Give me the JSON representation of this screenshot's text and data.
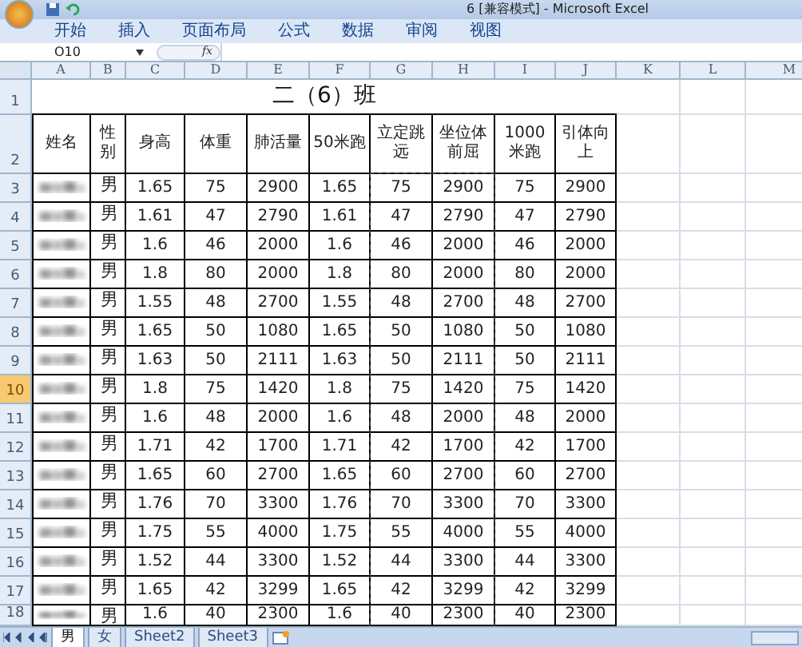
{
  "window": {
    "title": "6 [兼容模式] - Microsoft Excel"
  },
  "ribbon_tabs": [
    "开始",
    "插入",
    "页面布局",
    "公式",
    "数据",
    "审阅",
    "视图"
  ],
  "formula_bar": {
    "name_box": "O10",
    "function_label": "fx"
  },
  "columns": [
    {
      "label": "A",
      "marquee": false
    },
    {
      "label": "B",
      "marquee": false
    },
    {
      "label": "C",
      "marquee": false
    },
    {
      "label": "D",
      "marquee": false
    },
    {
      "label": "E",
      "marquee": false
    },
    {
      "label": "F",
      "marquee": false
    },
    {
      "label": "G",
      "marquee": true
    },
    {
      "label": "H",
      "marquee": true
    },
    {
      "label": "I",
      "marquee": false
    },
    {
      "label": "J",
      "marquee": false
    },
    {
      "label": "K",
      "marquee": false
    },
    {
      "label": "L",
      "marquee": false
    },
    {
      "label": "M",
      "marquee": false
    }
  ],
  "title_row": {
    "row": "1",
    "selected": false,
    "text": "二（6）班"
  },
  "header_row": {
    "row": "2",
    "selected": false,
    "cells": [
      "姓名",
      "性别",
      "身高",
      "体重",
      "肺活量",
      "50米跑",
      "立定跳远",
      "坐位体前屈",
      "1000米跑",
      "引体向上"
    ]
  },
  "rows": [
    {
      "row": "3",
      "selected": false,
      "cells": [
        "男",
        "1.65",
        "75",
        "2900",
        "1.65",
        "75",
        "2900",
        "75",
        "2900"
      ]
    },
    {
      "row": "4",
      "selected": false,
      "cells": [
        "男",
        "1.61",
        "47",
        "2790",
        "1.61",
        "47",
        "2790",
        "47",
        "2790"
      ]
    },
    {
      "row": "5",
      "selected": false,
      "cells": [
        "男",
        "1.6",
        "46",
        "2000",
        "1.6",
        "46",
        "2000",
        "46",
        "2000"
      ]
    },
    {
      "row": "6",
      "selected": false,
      "cells": [
        "男",
        "1.8",
        "80",
        "2000",
        "1.8",
        "80",
        "2000",
        "80",
        "2000"
      ]
    },
    {
      "row": "7",
      "selected": false,
      "cells": [
        "男",
        "1.55",
        "48",
        "2700",
        "1.55",
        "48",
        "2700",
        "48",
        "2700"
      ]
    },
    {
      "row": "8",
      "selected": false,
      "cells": [
        "男",
        "1.65",
        "50",
        "1080",
        "1.65",
        "50",
        "1080",
        "50",
        "1080"
      ]
    },
    {
      "row": "9",
      "selected": false,
      "cells": [
        "男",
        "1.63",
        "50",
        "2111",
        "1.63",
        "50",
        "2111",
        "50",
        "2111"
      ]
    },
    {
      "row": "10",
      "selected": true,
      "cells": [
        "男",
        "1.8",
        "75",
        "1420",
        "1.8",
        "75",
        "1420",
        "75",
        "1420"
      ]
    },
    {
      "row": "11",
      "selected": false,
      "cells": [
        "男",
        "1.6",
        "48",
        "2000",
        "1.6",
        "48",
        "2000",
        "48",
        "2000"
      ]
    },
    {
      "row": "12",
      "selected": false,
      "cells": [
        "男",
        "1.71",
        "42",
        "1700",
        "1.71",
        "42",
        "1700",
        "42",
        "1700"
      ]
    },
    {
      "row": "13",
      "selected": false,
      "cells": [
        "男",
        "1.65",
        "60",
        "2700",
        "1.65",
        "60",
        "2700",
        "60",
        "2700"
      ]
    },
    {
      "row": "14",
      "selected": false,
      "cells": [
        "男",
        "1.76",
        "70",
        "3300",
        "1.76",
        "70",
        "3300",
        "70",
        "3300"
      ]
    },
    {
      "row": "15",
      "selected": false,
      "cells": [
        "男",
        "1.75",
        "55",
        "4000",
        "1.75",
        "55",
        "4000",
        "55",
        "4000"
      ]
    },
    {
      "row": "16",
      "selected": false,
      "cells": [
        "男",
        "1.52",
        "44",
        "3300",
        "1.52",
        "44",
        "3300",
        "44",
        "3300"
      ]
    },
    {
      "row": "17",
      "selected": false,
      "cells": [
        "男",
        "1.65",
        "42",
        "3299",
        "1.65",
        "42",
        "3299",
        "42",
        "3299"
      ]
    },
    {
      "row": "18",
      "selected": false,
      "cells": [
        "男",
        "1.6",
        "40",
        "2300",
        "1.6",
        "40",
        "2300",
        "40",
        "2300"
      ]
    }
  ],
  "sheet_tabs": [
    {
      "label": "男",
      "selected": true
    },
    {
      "label": "女",
      "selected": false
    },
    {
      "label": "Sheet2",
      "selected": false
    },
    {
      "label": "Sheet3",
      "selected": false
    }
  ]
}
